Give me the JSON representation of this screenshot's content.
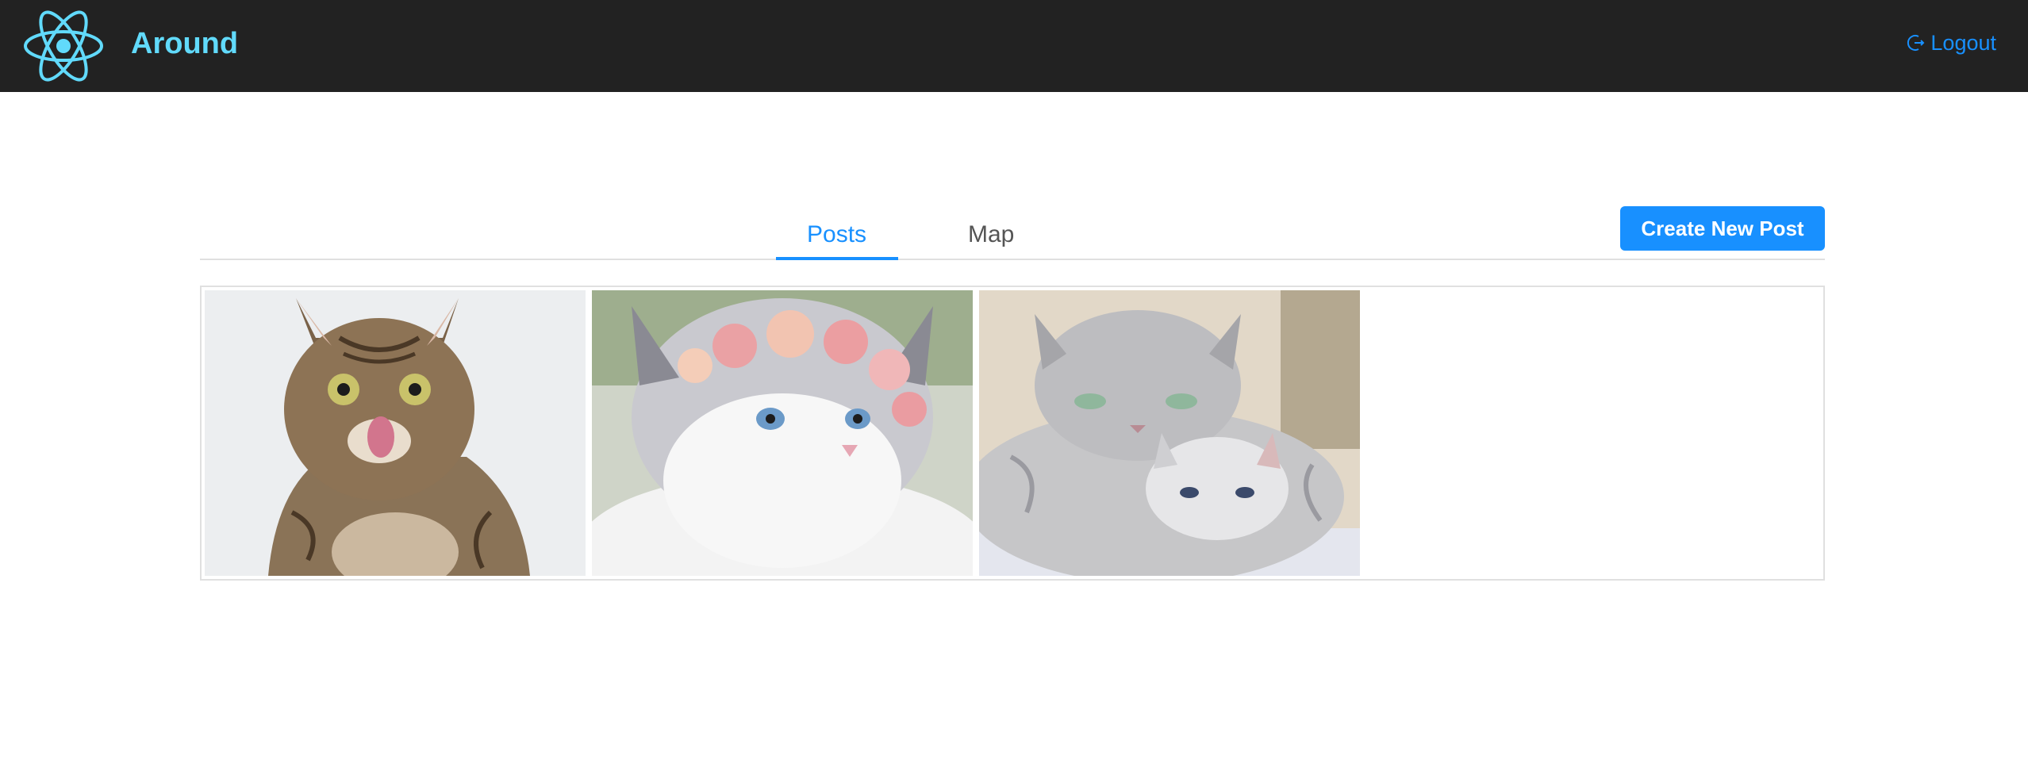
{
  "header": {
    "app_title": "Around",
    "logo_icon": "react-atom-icon",
    "logout_label": "Logout",
    "logout_icon": "logout-icon",
    "accent": "#61dafb",
    "background": "#222222"
  },
  "tabs": {
    "items": [
      {
        "label": "Posts",
        "active": true
      },
      {
        "label": "Map",
        "active": false
      }
    ],
    "active_color": "#1890ff"
  },
  "toolbar": {
    "create_label": "Create New Post",
    "button_color": "#1890ff"
  },
  "gallery": {
    "photos": [
      {
        "subject": "tabby cat licking lips"
      },
      {
        "subject": "ragdoll cat with flower crown"
      },
      {
        "subject": "silver cat with kitten"
      }
    ]
  }
}
